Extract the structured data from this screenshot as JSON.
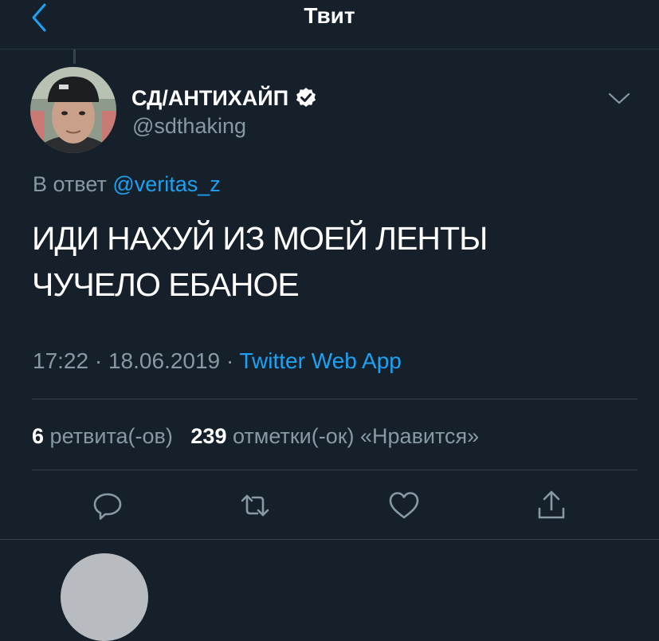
{
  "header": {
    "title": "Твит",
    "back_icon": "chevron-left-icon"
  },
  "tweet": {
    "author": {
      "name": "СД/АНТИХАЙП",
      "handle": "@sdthaking",
      "verified": true
    },
    "reply_prefix": "В ответ",
    "reply_mention": "@veritas_z",
    "text_lines": [
      "ИДИ НАХУЙ ИЗ МОЕЙ ЛЕНТЫ",
      "ЧУЧЕЛО ЕБАНОЕ"
    ],
    "time": "17:22",
    "separator": "·",
    "date": "18.06.2019",
    "source": "Twitter Web App"
  },
  "stats": {
    "retweets_count": "6",
    "retweets_label": "ретвита(-ов)",
    "likes_count": "239",
    "likes_label": "отметки(-ок) «Нравится»"
  },
  "actions": [
    "reply-icon",
    "retweet-icon",
    "like-icon",
    "share-icon"
  ],
  "colors": {
    "background": "#15202b",
    "accent": "#1da1f2",
    "secondary_text": "#8899a6",
    "divider": "#38444d"
  }
}
